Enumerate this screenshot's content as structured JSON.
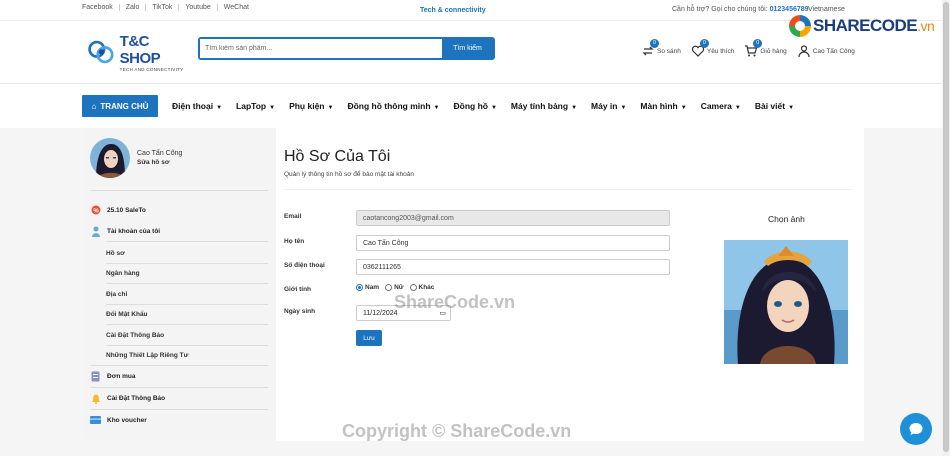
{
  "topbar": {
    "social": [
      "Facebook",
      "Zalo",
      "TikTok",
      "Youtube",
      "WeChat"
    ],
    "tagline": "Tech & connectivity",
    "support_label": "Cần hỗ trợ? Gọi cho chúng tôi:",
    "support_phone": "0123456789",
    "language": "Vietnamese"
  },
  "logo": {
    "name": "T&C SHOP",
    "sub": "TECH AND CONNECTIVITY"
  },
  "search": {
    "placeholder": "Tìm kiếm sản phẩm...",
    "button": "Tìm kiếm"
  },
  "header_icons": [
    {
      "icon": "compare-icon",
      "badge": "0",
      "label": "So sánh"
    },
    {
      "icon": "heart-icon",
      "badge": "0",
      "label": "Yêu thích"
    },
    {
      "icon": "cart-icon",
      "badge": "0",
      "label": "Giỏ hàng"
    },
    {
      "icon": "user-icon",
      "label": "Cao Tấn Công"
    }
  ],
  "watermark_logo": {
    "text": "SHARECODE",
    "suffix": ".vn"
  },
  "nav": {
    "home": "TRANG CHỦ",
    "items": [
      "Điện thoại",
      "LapTop",
      "Phụ kiện",
      "Đồng hồ thông minh",
      "Đồng hồ",
      "Máy tính bảng",
      "Máy in",
      "Màn hình",
      "Camera",
      "Bài viết"
    ]
  },
  "sidebar": {
    "user_name": "Cao Tấn Công",
    "edit_profile": "Sửa hồ sơ",
    "sale": "25.10 SaleTo",
    "account": "Tài khoản của tôi",
    "account_items": [
      "Hồ sơ",
      "Ngân hàng",
      "Địa chỉ",
      "Đổi Mật Khẩu",
      "Cài Đặt Thông Báo",
      "Những Thiết Lập Riêng Tư"
    ],
    "orders": "Đơn mua",
    "notifications": "Cài Đặt Thông Báo",
    "vouchers": "Kho voucher"
  },
  "profile": {
    "title": "Hồ Sơ Của Tôi",
    "subtitle": "Quản lý thông tin hồ sơ để bảo mật tài khoản",
    "email_label": "Email",
    "email_value": "caotancong2003@gmail.com",
    "name_label": "Họ tên",
    "name_value": "Cao Tấn Công",
    "phone_label": "Số điện thoại",
    "phone_value": "0362111265",
    "gender_label": "Giới tính",
    "gender_options": [
      "Nam",
      "Nữ",
      "Khác"
    ],
    "gender_selected": "Nam",
    "dob_label": "Ngày sinh",
    "dob_value": "11/12/2024",
    "save_button": "Lưu",
    "choose_photo": "Chọn ảnh"
  },
  "watermarks": {
    "center": "ShareCode.vn",
    "bottom": "Copyright © ShareCode.vn"
  }
}
